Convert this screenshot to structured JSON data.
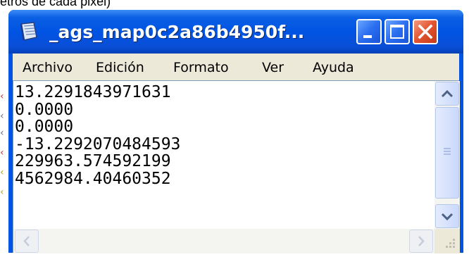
{
  "caption": {
    "text": "etros de cada pixel)"
  },
  "window": {
    "title": "_ags_map0c2a86b4950f...",
    "icon": "notepad-icon",
    "buttons": {
      "minimize": "minimize-icon",
      "maximize": "maximize-icon",
      "close": "close-icon"
    }
  },
  "menu": {
    "items": [
      "Archivo",
      "Edición",
      "Formato",
      "Ver",
      "Ayuda"
    ]
  },
  "content": {
    "lines": [
      "13.2291843971631",
      "0.0000",
      "0.0000",
      "-13.2292070484593",
      "229963.574592199",
      "4562984.40460352"
    ]
  },
  "colors": {
    "titlebar": "#0054e3",
    "close_button": "#e2532f",
    "menubar": "#ece9d8"
  }
}
